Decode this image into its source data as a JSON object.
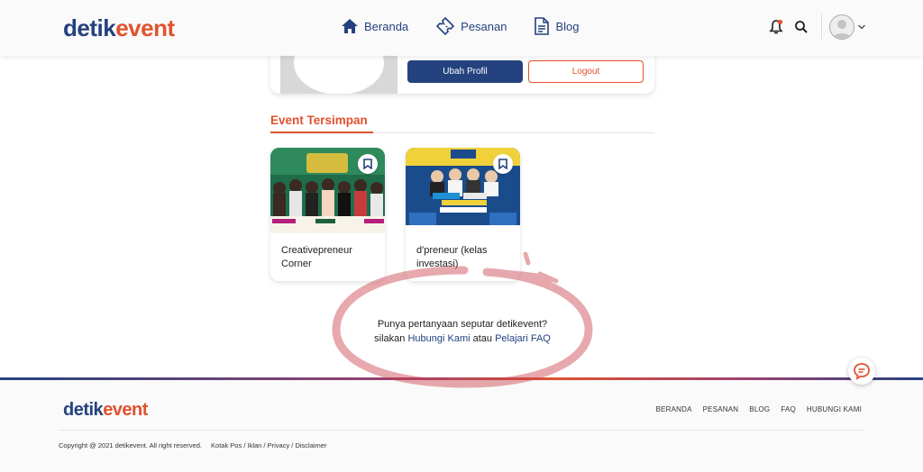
{
  "brand": {
    "part1": "detik",
    "part2": "event"
  },
  "nav": [
    {
      "label": "Beranda",
      "icon": "home-icon"
    },
    {
      "label": "Pesanan",
      "icon": "ticket-icon"
    },
    {
      "label": "Blog",
      "icon": "document-icon"
    }
  ],
  "header_icons": [
    "notification-bell-icon",
    "search-icon",
    "avatar",
    "chevron-down-icon"
  ],
  "profile": {
    "edit_label": "Ubah Profil",
    "logout_label": "Logout"
  },
  "saved_events": {
    "title": "Event Tersimpan",
    "items": [
      {
        "title": "Creativepreneur Corner"
      },
      {
        "title": "d'preneur (kelas investasi)"
      }
    ]
  },
  "help": {
    "question": "Punya pertanyaan seputar detikevent?",
    "prefix": "silakan",
    "contact_link": "Hubungi Kami",
    "middle": "atau",
    "faq_link": "Pelajari FAQ"
  },
  "footer": {
    "links": [
      "BERANDA",
      "PESANAN",
      "BLOG",
      "FAQ",
      "HUBUNGI KAMI"
    ],
    "copyright": "Copyright @ 2021 detikevent. All right reserved.",
    "legal": [
      "Kotak Pos",
      "Iklan",
      "Privacy",
      "Disclaimer"
    ]
  },
  "colors": {
    "primary": "#24427e",
    "accent": "#e0522e"
  }
}
